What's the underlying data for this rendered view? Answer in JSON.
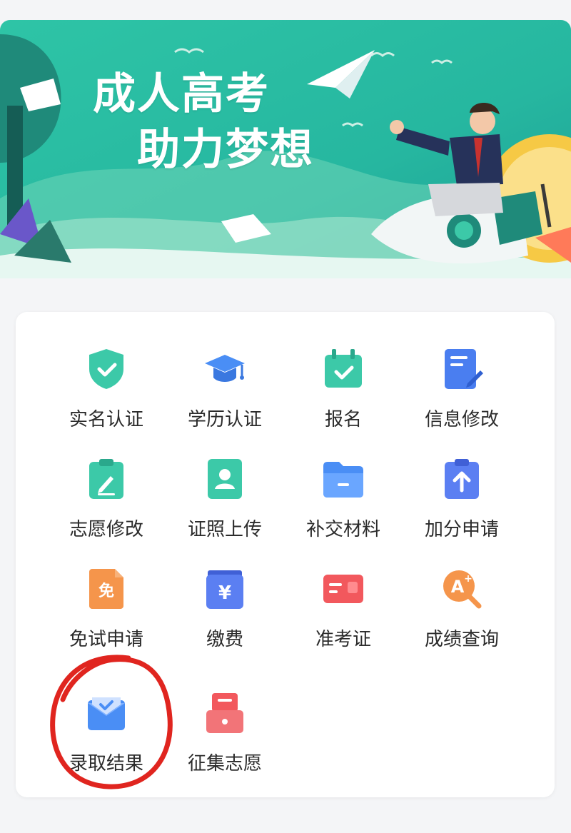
{
  "banner": {
    "title_line1": "成人高考",
    "title_line2": "助力梦想"
  },
  "services": [
    {
      "label": "实名认证",
      "icon": "shield-check-icon",
      "color": "#3cc9a8"
    },
    {
      "label": "学历认证",
      "icon": "graduation-cap-icon",
      "color": "#4a8ef5"
    },
    {
      "label": "报名",
      "icon": "calendar-check-icon",
      "color": "#3cc9a8"
    },
    {
      "label": "信息修改",
      "icon": "document-edit-icon",
      "color": "#4a7ef0"
    },
    {
      "label": "志愿修改",
      "icon": "clipboard-edit-icon",
      "color": "#3cc9a8"
    },
    {
      "label": "证照上传",
      "icon": "id-photo-icon",
      "color": "#3cc9a8"
    },
    {
      "label": "补交材料",
      "icon": "folder-icon",
      "color": "#4a8ef5"
    },
    {
      "label": "加分申请",
      "icon": "clipboard-up-icon",
      "color": "#5b7ff2"
    },
    {
      "label": "免试申请",
      "icon": "exempt-document-icon",
      "color": "#f5954b"
    },
    {
      "label": "缴费",
      "icon": "yuan-wallet-icon",
      "color": "#5b7ff2"
    },
    {
      "label": "准考证",
      "icon": "admission-card-icon",
      "color": "#f2585d"
    },
    {
      "label": "成绩查询",
      "icon": "grade-search-icon",
      "color": "#f5954b"
    },
    {
      "label": "录取结果",
      "icon": "envelope-check-icon",
      "color": "#4a8ef5"
    },
    {
      "label": "征集志愿",
      "icon": "drawer-icon",
      "color": "#f2585d"
    }
  ]
}
